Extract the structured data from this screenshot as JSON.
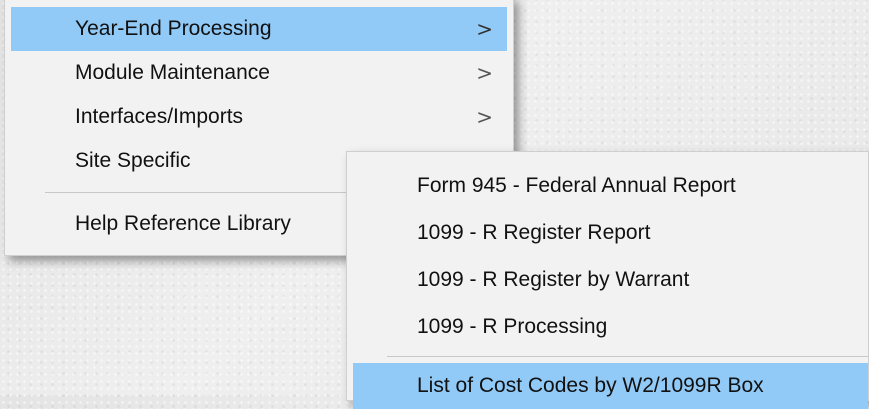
{
  "main_menu": {
    "items": [
      {
        "label": "Year-End Processing",
        "submenu_arrow": ">"
      },
      {
        "label": "Module Maintenance",
        "submenu_arrow": ">"
      },
      {
        "label": "Interfaces/Imports",
        "submenu_arrow": ">"
      },
      {
        "label": "Site Specific"
      },
      {
        "label": "Help Reference Library"
      }
    ]
  },
  "sub_menu": {
    "items": [
      {
        "label": "Form 945 - Federal Annual Report"
      },
      {
        "label": "1099 - R Register Report"
      },
      {
        "label": "1099 - R Register by Warrant"
      },
      {
        "label": "1099 - R Processing"
      },
      {
        "label": "List of Cost Codes by W2/1099R Box"
      }
    ]
  },
  "colors": {
    "highlight": "#91c9f7",
    "menu_background": "#f2f2f2",
    "separator": "#c8c8c8"
  }
}
